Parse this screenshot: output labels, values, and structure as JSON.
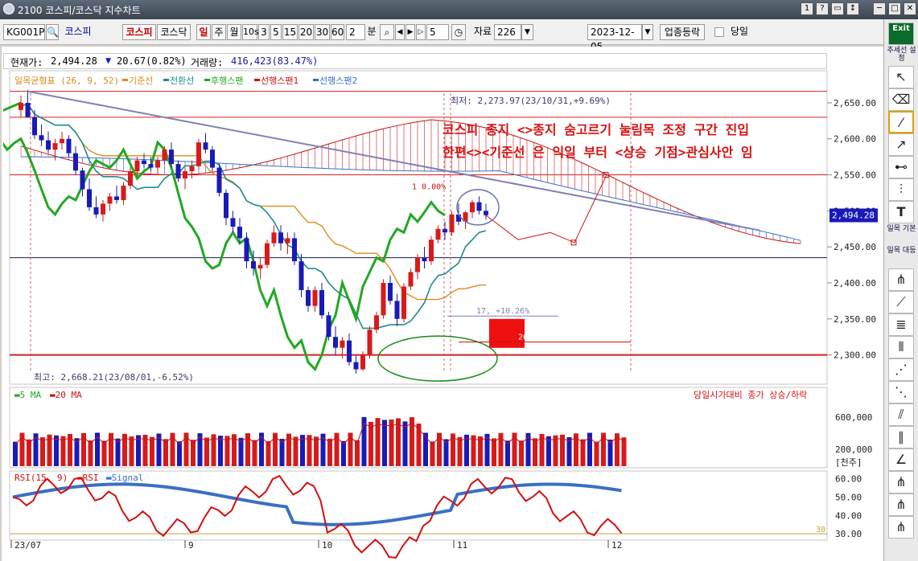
{
  "window": {
    "title": "2100 코스피/코스닥 지수차트",
    "buttons": [
      "1",
      "?",
      "▭",
      "↕",
      "─",
      "□",
      "✕"
    ]
  },
  "toolbar": {
    "code": "KG001P",
    "code_name": "코스피",
    "market_tabs": [
      "코스피",
      "코스닥"
    ],
    "period_tabs": [
      "일",
      "주",
      "월",
      "10s",
      "3",
      "5",
      "15",
      "20",
      "30",
      "60"
    ],
    "interval_value": "2",
    "interval_unit": "분",
    "count_value": "5",
    "data_label": "자료",
    "data_count": "226",
    "date": "2023-12-05",
    "industry_button": "업종등락",
    "today_label": "당일"
  },
  "info": {
    "current_label": "현재가:",
    "current_price": "2,494.28",
    "change_arrow": "▼",
    "change": "20.67(0.82%)",
    "volume_label": "거래량:",
    "volume": "416,423(83.47%)"
  },
  "legend": {
    "ichimoku": "일목균형표 (26, 9, 52)",
    "items": [
      {
        "label": "기준선",
        "color": "#e08a1e"
      },
      {
        "label": "전환선",
        "color": "#1e8c8c"
      },
      {
        "label": "후행스팬",
        "color": "#22a822"
      },
      {
        "label": "선행스팬1",
        "color": "#d01010"
      },
      {
        "label": "선행스팬2",
        "color": "#3a6fc4"
      }
    ]
  },
  "annotations": {
    "low_label": "최저: 2,273.97(23/10/31,+9.69%)",
    "high_label": "최고: 2,668.21(23/08/01,-6.52%)",
    "note_line1": "코스피 종지 <>종지 숨고르기 눌림목 조정 구간 진입",
    "note_line2": "한편<><기준선 은 익일 부터 <상승 기점>관심사안 임",
    "pct_label": "1 0.00%",
    "bars_label_1": "17, +10.26%",
    "bars_label_2": "26, +6.37%",
    "current_price_tag": "2,494.28"
  },
  "price_axis": [
    "2,650.00",
    "2,600.00",
    "2,550.00",
    "2,500.00",
    "2,450.00",
    "2,400.00",
    "2,350.00",
    "2,300.00"
  ],
  "volume_panel": {
    "legend": [
      "5 MA",
      "20 MA"
    ],
    "note": "당일시가대비 종가 상승/하락",
    "axis": [
      "600,000",
      "200,000"
    ],
    "unit": "[천주]"
  },
  "rsi_panel": {
    "legend": [
      "RSI(15, 9)",
      "RSI",
      "Signal"
    ],
    "axis": [
      "60.00",
      "50.00",
      "40.00",
      "30.00"
    ],
    "level_30": "30"
  },
  "x_axis": [
    "23/07",
    "9",
    "10",
    "11",
    "12"
  ],
  "right_toolbar": {
    "exit": "Exit",
    "trend_setting": "추세선 설정",
    "ichimoku_basic": "일목 기본",
    "ichimoku_contrast": "일목 대등"
  },
  "colors": {
    "up": "#d81a1a",
    "down": "#1a1ab8",
    "title_bg": "#3b4450"
  },
  "chart_data": {
    "type": "candlestick",
    "title": "",
    "ylim": [
      2275,
      2670
    ],
    "candles": [
      [
        2640,
        2660,
        2630,
        2650
      ],
      [
        2650,
        2668,
        2640,
        2630
      ],
      [
        2630,
        2640,
        2600,
        2605
      ],
      [
        2605,
        2620,
        2590,
        2598
      ],
      [
        2598,
        2610,
        2580,
        2585
      ],
      [
        2585,
        2600,
        2570,
        2594
      ],
      [
        2594,
        2610,
        2585,
        2600
      ],
      [
        2600,
        2605,
        2575,
        2580
      ],
      [
        2580,
        2590,
        2550,
        2556
      ],
      [
        2556,
        2560,
        2520,
        2530
      ],
      [
        2530,
        2545,
        2500,
        2505
      ],
      [
        2505,
        2520,
        2490,
        2495
      ],
      [
        2495,
        2515,
        2485,
        2510
      ],
      [
        2510,
        2525,
        2500,
        2520
      ],
      [
        2520,
        2535,
        2510,
        2515
      ],
      [
        2515,
        2540,
        2508,
        2535
      ],
      [
        2535,
        2560,
        2530,
        2555
      ],
      [
        2555,
        2575,
        2548,
        2570
      ],
      [
        2570,
        2580,
        2560,
        2565
      ],
      [
        2565,
        2575,
        2555,
        2560
      ],
      [
        2560,
        2575,
        2550,
        2570
      ],
      [
        2570,
        2590,
        2565,
        2585
      ],
      [
        2585,
        2595,
        2560,
        2565
      ],
      [
        2565,
        2570,
        2540,
        2545
      ],
      [
        2545,
        2560,
        2530,
        2555
      ],
      [
        2555,
        2570,
        2545,
        2562
      ],
      [
        2562,
        2600,
        2558,
        2595
      ],
      [
        2595,
        2608,
        2580,
        2585
      ],
      [
        2585,
        2590,
        2555,
        2560
      ],
      [
        2560,
        2565,
        2520,
        2525
      ],
      [
        2525,
        2530,
        2480,
        2490
      ],
      [
        2490,
        2500,
        2470,
        2478
      ],
      [
        2478,
        2490,
        2455,
        2462
      ],
      [
        2462,
        2470,
        2420,
        2430
      ],
      [
        2430,
        2445,
        2410,
        2420
      ],
      [
        2420,
        2435,
        2405,
        2425
      ],
      [
        2425,
        2460,
        2420,
        2455
      ],
      [
        2455,
        2480,
        2450,
        2470
      ],
      [
        2470,
        2480,
        2445,
        2455
      ],
      [
        2455,
        2470,
        2440,
        2462
      ],
      [
        2462,
        2470,
        2425,
        2430
      ],
      [
        2430,
        2440,
        2380,
        2390
      ],
      [
        2390,
        2395,
        2360,
        2368
      ],
      [
        2368,
        2395,
        2360,
        2390
      ],
      [
        2390,
        2400,
        2350,
        2355
      ],
      [
        2355,
        2360,
        2320,
        2325
      ],
      [
        2325,
        2340,
        2300,
        2310
      ],
      [
        2310,
        2325,
        2295,
        2320
      ],
      [
        2320,
        2330,
        2285,
        2290
      ],
      [
        2290,
        2300,
        2274,
        2280
      ],
      [
        2280,
        2305,
        2278,
        2300
      ],
      [
        2300,
        2340,
        2295,
        2335
      ],
      [
        2335,
        2360,
        2330,
        2355
      ],
      [
        2355,
        2405,
        2350,
        2400
      ],
      [
        2400,
        2410,
        2370,
        2375
      ],
      [
        2375,
        2385,
        2340,
        2350
      ],
      [
        2350,
        2400,
        2345,
        2395
      ],
      [
        2395,
        2420,
        2390,
        2415
      ],
      [
        2415,
        2440,
        2405,
        2435
      ],
      [
        2435,
        2450,
        2420,
        2430
      ],
      [
        2430,
        2465,
        2425,
        2460
      ],
      [
        2460,
        2480,
        2455,
        2475
      ],
      [
        2475,
        2485,
        2460,
        2470
      ],
      [
        2470,
        2500,
        2465,
        2495
      ],
      [
        2495,
        2510,
        2480,
        2485
      ],
      [
        2485,
        2500,
        2475,
        2498
      ],
      [
        2498,
        2515,
        2490,
        2512
      ],
      [
        2512,
        2520,
        2495,
        2500
      ],
      [
        2500,
        2510,
        2488,
        2494
      ]
    ]
  }
}
